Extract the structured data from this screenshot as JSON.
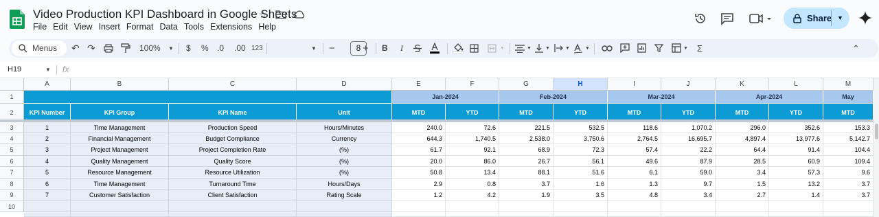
{
  "app": {
    "title": "Video Production KPI Dashboard in Google Sheets"
  },
  "menu": [
    "File",
    "Edit",
    "View",
    "Insert",
    "Format",
    "Data",
    "Tools",
    "Extensions",
    "Help"
  ],
  "toolbar": {
    "menus_label": "Menus",
    "zoom": "100%",
    "currency": "$",
    "percent": "%",
    "dec_dec": ".0",
    "dec_inc": ".00",
    "num_fmt": "123",
    "font_size": "8",
    "minus": "−",
    "plus": "+",
    "bold": "B",
    "italic": "I"
  },
  "share": {
    "label": "Share"
  },
  "formula_bar": {
    "name_box": "H19",
    "fx": "fx"
  },
  "colors": {
    "header_blue": "#0d9bd6",
    "header_light": "#a6c8ef",
    "cell_light": "#e7eef8",
    "share_bg": "#c2e7ff"
  },
  "columns": [
    "A",
    "B",
    "C",
    "D",
    "E",
    "F",
    "G",
    "H",
    "I",
    "J",
    "K",
    "L",
    "M"
  ],
  "rows": [
    "1",
    "2",
    "3",
    "4",
    "5",
    "6",
    "7",
    "8",
    "9",
    "10"
  ],
  "headers": {
    "kpi_number": "KPI Number",
    "kpi_group": "KPI Group",
    "kpi_name": "KPI Name",
    "unit": "Unit",
    "months": [
      "Jan-2024",
      "Feb-2024",
      "Mar-2024",
      "Apr-2024",
      "May"
    ],
    "mtd": "MTD",
    "ytd": "YTD"
  },
  "kpis": [
    {
      "num": "1",
      "group": "Time Management",
      "name": "Production Speed",
      "unit": "Hours/Minutes",
      "vals": [
        "240.0",
        "72.6",
        "221.5",
        "532.5",
        "118.6",
        "1,070.2",
        "296.0",
        "352.6",
        "153.3"
      ]
    },
    {
      "num": "2",
      "group": "Financial Management",
      "name": "Budget Compliance",
      "unit": "Currency",
      "vals": [
        "644.3",
        "1,740.5",
        "2,538.0",
        "3,750.6",
        "2,764.5",
        "16,695.7",
        "4,897.4",
        "13,977.6",
        "5,142.7"
      ]
    },
    {
      "num": "3",
      "group": "Project Management",
      "name": "Project Completion Rate",
      "unit": "(%)",
      "vals": [
        "61.7",
        "92.1",
        "68.9",
        "72.3",
        "57.4",
        "22.2",
        "64.4",
        "91.4",
        "104.4"
      ]
    },
    {
      "num": "4",
      "group": "Quality Management",
      "name": "Quality Score",
      "unit": "(%)",
      "vals": [
        "20.0",
        "86.0",
        "26.7",
        "56.1",
        "49.6",
        "87.9",
        "28.5",
        "60.9",
        "109.4"
      ]
    },
    {
      "num": "5",
      "group": "Resource Management",
      "name": "Resource Utilization",
      "unit": "(%)",
      "vals": [
        "50.8",
        "13.4",
        "88.1",
        "51.6",
        "6.1",
        "59.0",
        "3.4",
        "57.3",
        "9.6"
      ]
    },
    {
      "num": "6",
      "group": "Time Management",
      "name": "Turnaround Time",
      "unit": "Hours/Days",
      "vals": [
        "2.9",
        "0.8",
        "3.7",
        "1.6",
        "1.3",
        "9.7",
        "1.5",
        "13.2",
        "3.7"
      ]
    },
    {
      "num": "7",
      "group": "Customer Satisfaction",
      "name": "Client Satisfaction",
      "unit": "Rating Scale",
      "vals": [
        "1.2",
        "4.2",
        "1.9",
        "3.5",
        "4.8",
        "3.4",
        "2.7",
        "1.4",
        "3.7"
      ]
    }
  ]
}
